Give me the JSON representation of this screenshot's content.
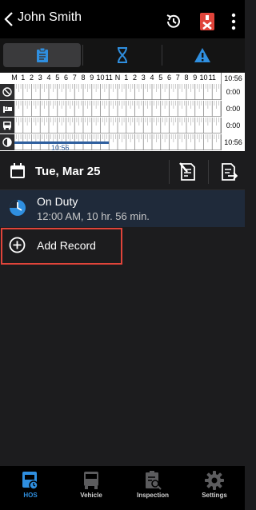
{
  "header": {
    "title": "John Smith"
  },
  "tabs": [
    {
      "name": "log",
      "icon": "clipboard-icon",
      "active": true
    },
    {
      "name": "timer",
      "icon": "hourglass-icon",
      "active": false
    },
    {
      "name": "alerts",
      "icon": "warning-icon",
      "active": false
    }
  ],
  "grid": {
    "hour_labels": [
      "M",
      "1",
      "2",
      "3",
      "4",
      "5",
      "6",
      "7",
      "8",
      "9",
      "10",
      "11",
      "N",
      "1",
      "2",
      "3",
      "4",
      "5",
      "6",
      "7",
      "8",
      "9",
      "10",
      "11"
    ],
    "total": "10:56",
    "rows": [
      {
        "status": "off-duty",
        "icon": "off-duty-icon",
        "total": "0:00"
      },
      {
        "status": "sleeper",
        "icon": "sleeper-berth-icon",
        "total": "0:00"
      },
      {
        "status": "driving",
        "icon": "driving-truck-icon",
        "total": "0:00"
      },
      {
        "status": "on-duty",
        "icon": "on-duty-clock-icon",
        "total": "10:56"
      }
    ],
    "duty_label": "10:56",
    "on_duty_progress": 0.456
  },
  "date": {
    "label": "Tue, Mar 25"
  },
  "records": [
    {
      "title": "On Duty",
      "subtitle": "12:00 AM, 10 hr. 56 min."
    }
  ],
  "add_record": {
    "label": "Add Record"
  },
  "nav": [
    {
      "label": "HOS",
      "active": true,
      "icon": "hos-icon"
    },
    {
      "label": "Vehicle",
      "active": false,
      "icon": "vehicle-icon"
    },
    {
      "label": "Inspection",
      "active": false,
      "icon": "inspection-icon"
    },
    {
      "label": "Settings",
      "active": false,
      "icon": "settings-gear-icon"
    }
  ],
  "colors": {
    "accent": "#2f8fe0",
    "alert": "#e0443a",
    "duty": "#2f5f9e"
  }
}
